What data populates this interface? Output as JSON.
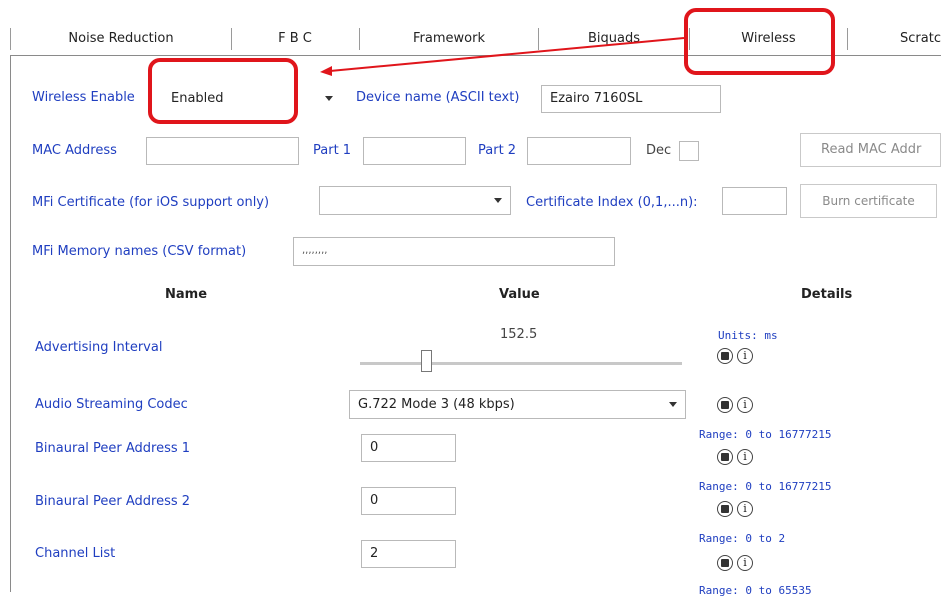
{
  "tabs": [
    {
      "label": "Noise Reduction"
    },
    {
      "label": "F B C"
    },
    {
      "label": "Framework"
    },
    {
      "label": "Biquads"
    },
    {
      "label": "Wireless"
    },
    {
      "label": "Scratc"
    }
  ],
  "top_form": {
    "wireless_enable_label": "Wireless Enable",
    "wireless_enable_value": "Enabled",
    "device_name_label": "Device name (ASCII text)",
    "device_name_value": "Ezairo 7160SL",
    "mac_address_label": "MAC Address",
    "mac_address_value": "",
    "part1_label": "Part 1",
    "part1_value": "",
    "part2_label": "Part 2",
    "part2_value": "",
    "dec_label": "Dec",
    "read_mac_button": "Read MAC Addr",
    "mfi_cert_label": "MFi Certificate (for iOS support only)",
    "mfi_cert_value": "",
    "cert_index_label": "Certificate Index (0,1,...n):",
    "cert_index_value": "",
    "burn_cert_button": "Burn certificate",
    "mfi_memory_label": "MFi Memory names (CSV format)",
    "mfi_memory_value": ",,,,,,,,"
  },
  "table": {
    "headers": {
      "name": "Name",
      "value": "Value",
      "details": "Details"
    },
    "rows": [
      {
        "name": "Advertising Interval",
        "value": "152.5",
        "details": "Units: ms",
        "slider_fraction": 0.19
      },
      {
        "name": "Audio Streaming Codec",
        "value": "G.722 Mode 3  (48 kbps)",
        "details": ""
      },
      {
        "name": "Binaural Peer Address 1",
        "value": "0",
        "details": "Range: 0 to 16777215"
      },
      {
        "name": "Binaural Peer Address 2",
        "value": "0",
        "details": "Range: 0 to 16777215"
      },
      {
        "name": "Channel List",
        "value": "2",
        "details": "Range: 0 to 2"
      }
    ],
    "partial_details": "Range: 0 to 65535"
  },
  "icons": {
    "reset": "reset-icon",
    "info": "info-icon"
  },
  "info_glyph": "i",
  "colors": {
    "label_blue": "#1f3ec0",
    "highlight_red": "#e0151b"
  }
}
